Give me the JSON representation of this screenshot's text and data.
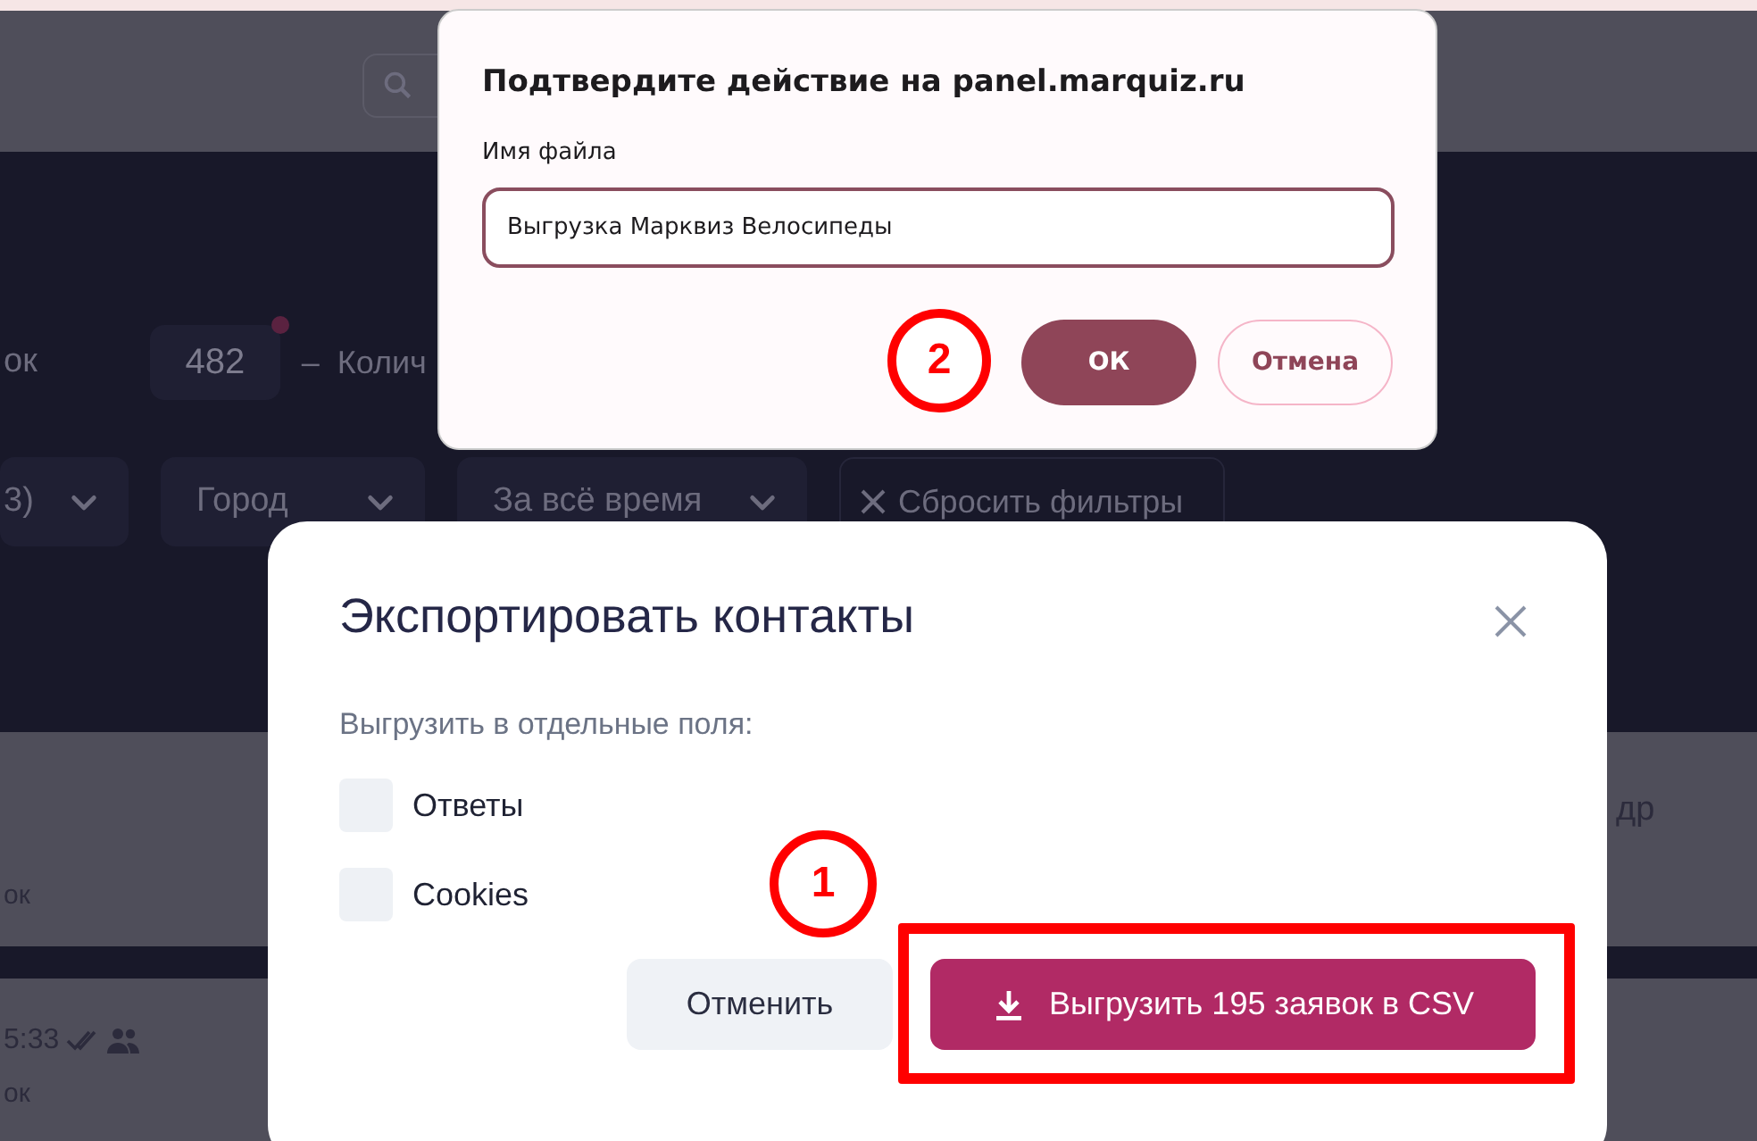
{
  "background": {
    "counter": {
      "label": "ок",
      "count": "482",
      "caption": "–  Колич"
    },
    "filters": [
      {
        "kind": "dropdown",
        "label": "3)"
      },
      {
        "kind": "dropdown",
        "label": "Город"
      },
      {
        "kind": "dropdown",
        "label": "За всё время"
      },
      {
        "kind": "reset",
        "label": "Сбросить фильтры"
      }
    ],
    "rows": [
      {
        "line_2": "ок",
        "column_right": "др"
      },
      {
        "time": "5:33",
        "line_2": "ок"
      }
    ]
  },
  "export_dialog": {
    "title": "Экспортировать контакты",
    "subtitle": "Выгрузить в отдельные поля:",
    "options": [
      {
        "label": "Ответы",
        "checked": false
      },
      {
        "label": "Cookies",
        "checked": false
      }
    ],
    "cancel_button": "Отменить",
    "export_button": "Выгрузить 195 заявок в CSV"
  },
  "confirm_dialog": {
    "title": "Подтвердите действие на panel.marquiz.ru",
    "field_label": "Имя файла",
    "field_value": "Выгрузка Марквиз Велосипеды",
    "ok_button": "ОК",
    "cancel_button": "Отмена"
  },
  "annotations": [
    {
      "label": "1"
    },
    {
      "label": "2"
    }
  ]
}
